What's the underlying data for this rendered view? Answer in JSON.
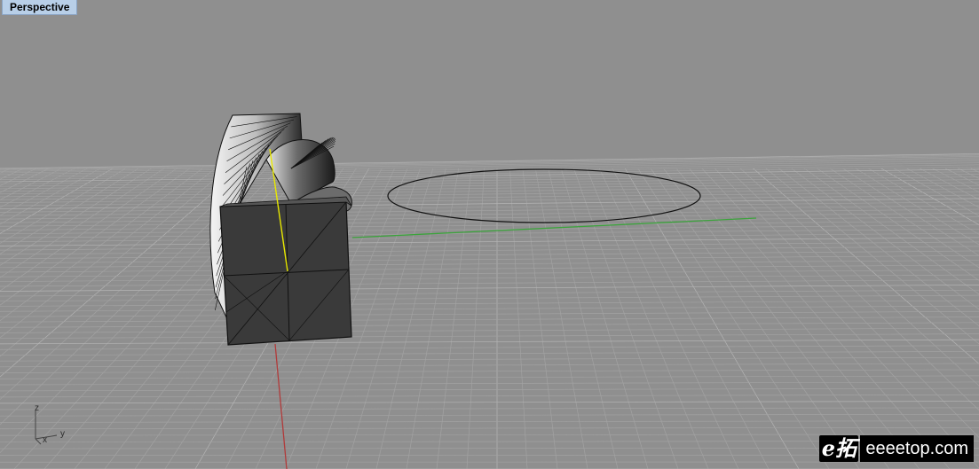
{
  "viewport": {
    "title": "Perspective",
    "background": "#8f8f8f"
  },
  "axis_widget": {
    "z_label": "z",
    "x_label": "x",
    "y_label": "y"
  },
  "watermark": {
    "logo_text": "e拓",
    "site_text": "eeeetop.com"
  },
  "colors": {
    "grid_minor": "#a2a2a2",
    "grid_major": "#b4b4b4",
    "x_axis": "#b13a3a",
    "y_axis": "#3ca33c",
    "selected_edge": "#e8e800",
    "surface_dark": "#3a3a3a",
    "curve": "#111111"
  },
  "objects": [
    {
      "name": "twisted-sweep-surface",
      "type": "surface"
    },
    {
      "name": "box-solid",
      "type": "polysurface"
    },
    {
      "name": "circle-curve",
      "type": "curve"
    }
  ]
}
